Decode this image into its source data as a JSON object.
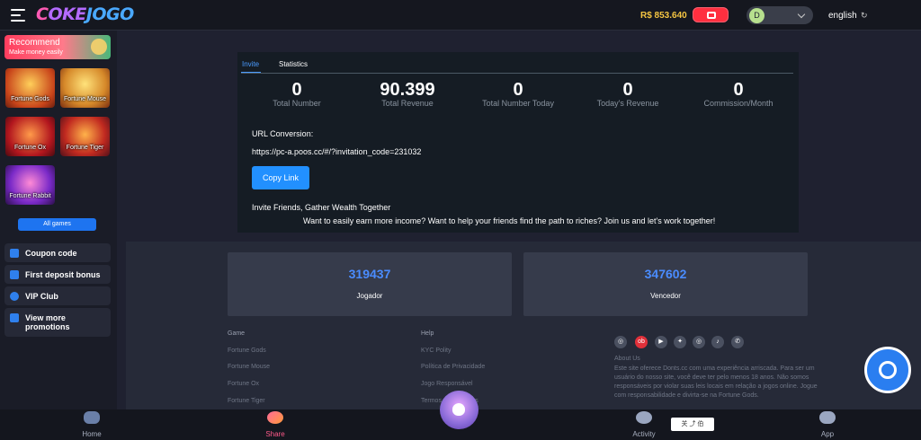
{
  "header": {
    "logo": {
      "part1": "C",
      "part2": "OKE",
      "part3": "JOGO"
    },
    "balance": "R$ 853.640",
    "avatar_initial": "D",
    "language": "english",
    "language_icon": "↻"
  },
  "sidebar": {
    "recommend": {
      "title": "Recommend",
      "subtitle": "Make money easily"
    },
    "games": [
      "Fortune Gods",
      "Fortune Mouse",
      "Fortune Ox",
      "Fortune Tiger",
      "Fortune Rabbit"
    ],
    "all_games": "All games",
    "links": [
      "Coupon code",
      "First deposit bonus",
      "VIP Club",
      "View more promotions"
    ]
  },
  "invite": {
    "tabs": [
      "Invite",
      "Statistics"
    ],
    "stats": [
      {
        "value": "0",
        "label": "Total Number"
      },
      {
        "value": "90.399",
        "label": "Total Revenue"
      },
      {
        "value": "0",
        "label": "Total Number Today"
      },
      {
        "value": "0",
        "label": "Today's Revenue"
      },
      {
        "value": "0",
        "label": "Commission/Month"
      }
    ],
    "url_label": "URL Conversion:",
    "url": "https://pc-a.poos.cc/#/?invitation_code=231032",
    "copy_label": "Copy Link",
    "title": "Invite Friends, Gather Wealth Together",
    "description": "Want to easily earn more income? Want to help your friends find the path to riches? Join us and let's work together!"
  },
  "cards": [
    {
      "number": "319437",
      "caption": "Jogador"
    },
    {
      "number": "347602",
      "caption": "Vencedor"
    }
  ],
  "footer": {
    "game_head": "Game",
    "game_items": [
      "Fortune Gods",
      "Fortune Mouse",
      "Fortune Ox",
      "Fortune Tiger"
    ],
    "help_head": "Help",
    "help_items": [
      "KYC Polity",
      "Política de Privacidade",
      "Jogo Responsável",
      "Termos e Condições"
    ],
    "social_icons": [
      "instagram-icon",
      "obs-icon",
      "youtube-icon",
      "twitter-icon",
      "instagram-icon",
      "tiktok-icon",
      "whatsapp-icon"
    ],
    "social_glyphs": [
      "◎",
      "ob",
      "▶",
      "✦",
      "◎",
      "♪",
      "✆"
    ],
    "about_head": "About Us",
    "about_text": "Este site oferece Donts.cc com uma experiência arriscada. Para ser um usuário do nosso site, você deve ter pelo menos 18 anos. Não somos responsáveis por violar suas leis locais em relação a jogos online. Jogue com responsabilidade e divirta-se na Fortune Gods."
  },
  "bottom_nav": [
    "Home",
    "Share",
    "Activity",
    "App"
  ],
  "mini_tool": "关 ⤴ 伯",
  "colors": {
    "accent": "#2290ff",
    "balance": "#f5c542",
    "deposit": "#ff2f3f",
    "share": "#ff5a8a"
  }
}
